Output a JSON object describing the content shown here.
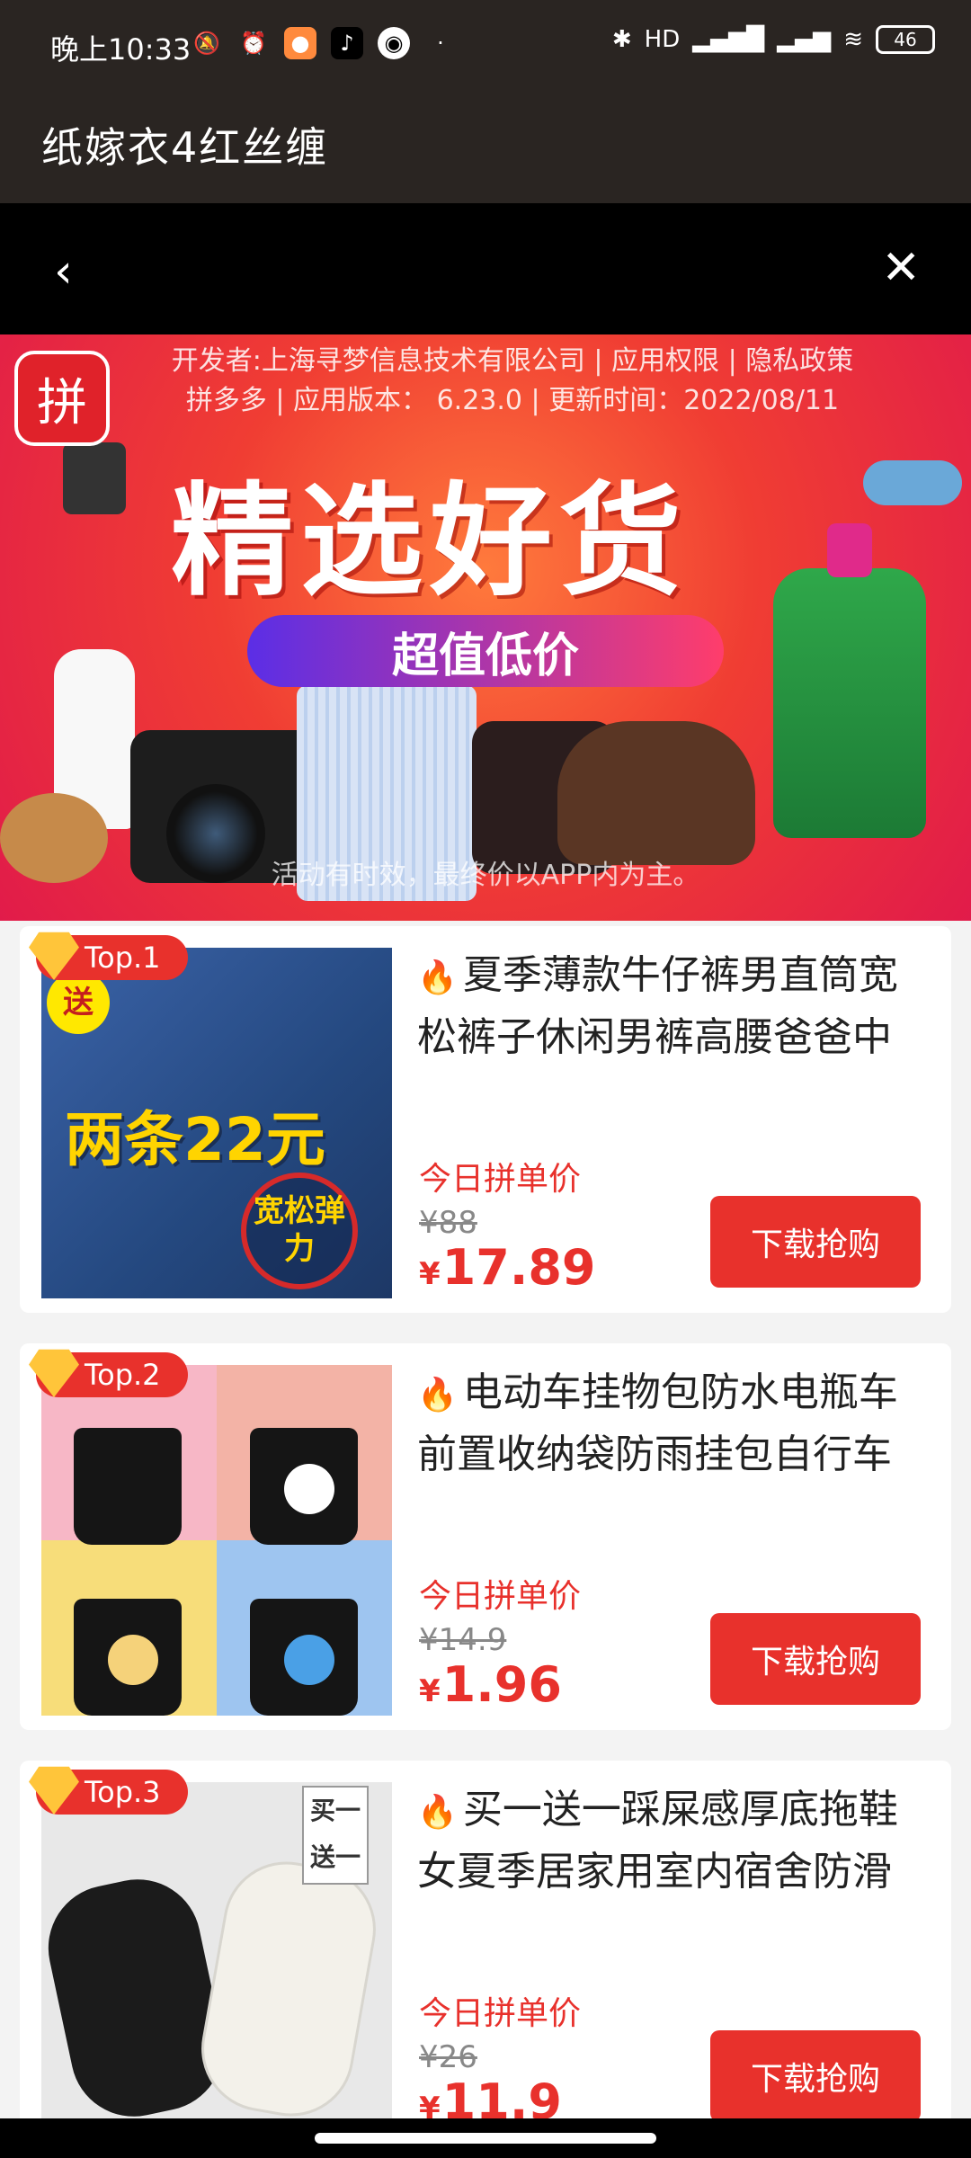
{
  "status_bar": {
    "time": "晚上10:33",
    "battery": "46",
    "network": "HD"
  },
  "app": {
    "title": "纸嫁衣4红丝缠"
  },
  "nav": {
    "back_icon": "chevron-left-icon",
    "close_icon": "close-icon"
  },
  "banner": {
    "logo_text": "拼",
    "meta_line1": "开发者:上海寻梦信息技术有限公司 | 应用权限 | 隐私政策",
    "meta_line2": "拼多多 | 应用版本： 6.23.0 | 更新时间：2022/08/11",
    "headline": "精选好货",
    "subheadline": "超值低价",
    "footer": "活动有时效，最终价以APP内为主。"
  },
  "products": [
    {
      "rank": "Top.1",
      "title": "夏季薄款牛仔裤男直筒宽松裤子休闲男裤高腰爸爸中",
      "price_label": "今日拼单价",
      "original_price": "¥88",
      "currency": "¥",
      "price": "17.89",
      "button": "下载抢购",
      "img_promo": "两条22元",
      "img_circle": "宽松弹力",
      "img_sticker": "送"
    },
    {
      "rank": "Top.2",
      "title": "电动车挂物包防水电瓶车前置收纳袋防雨挂包自行车",
      "price_label": "今日拼单价",
      "original_price": "¥14.9",
      "currency": "¥",
      "price": "1.96",
      "button": "下载抢购"
    },
    {
      "rank": "Top.3",
      "title": "买一送一踩屎感厚底拖鞋女夏季居家用室内宿舍防滑",
      "price_label": "今日拼单价",
      "original_price": "¥26",
      "currency": "¥",
      "price": "11.9",
      "button": "下载抢购",
      "img_tag": "买一送一"
    }
  ],
  "colors": {
    "accent": "#e8312c",
    "topbar": "#2a2522",
    "navbar": "#000000"
  }
}
